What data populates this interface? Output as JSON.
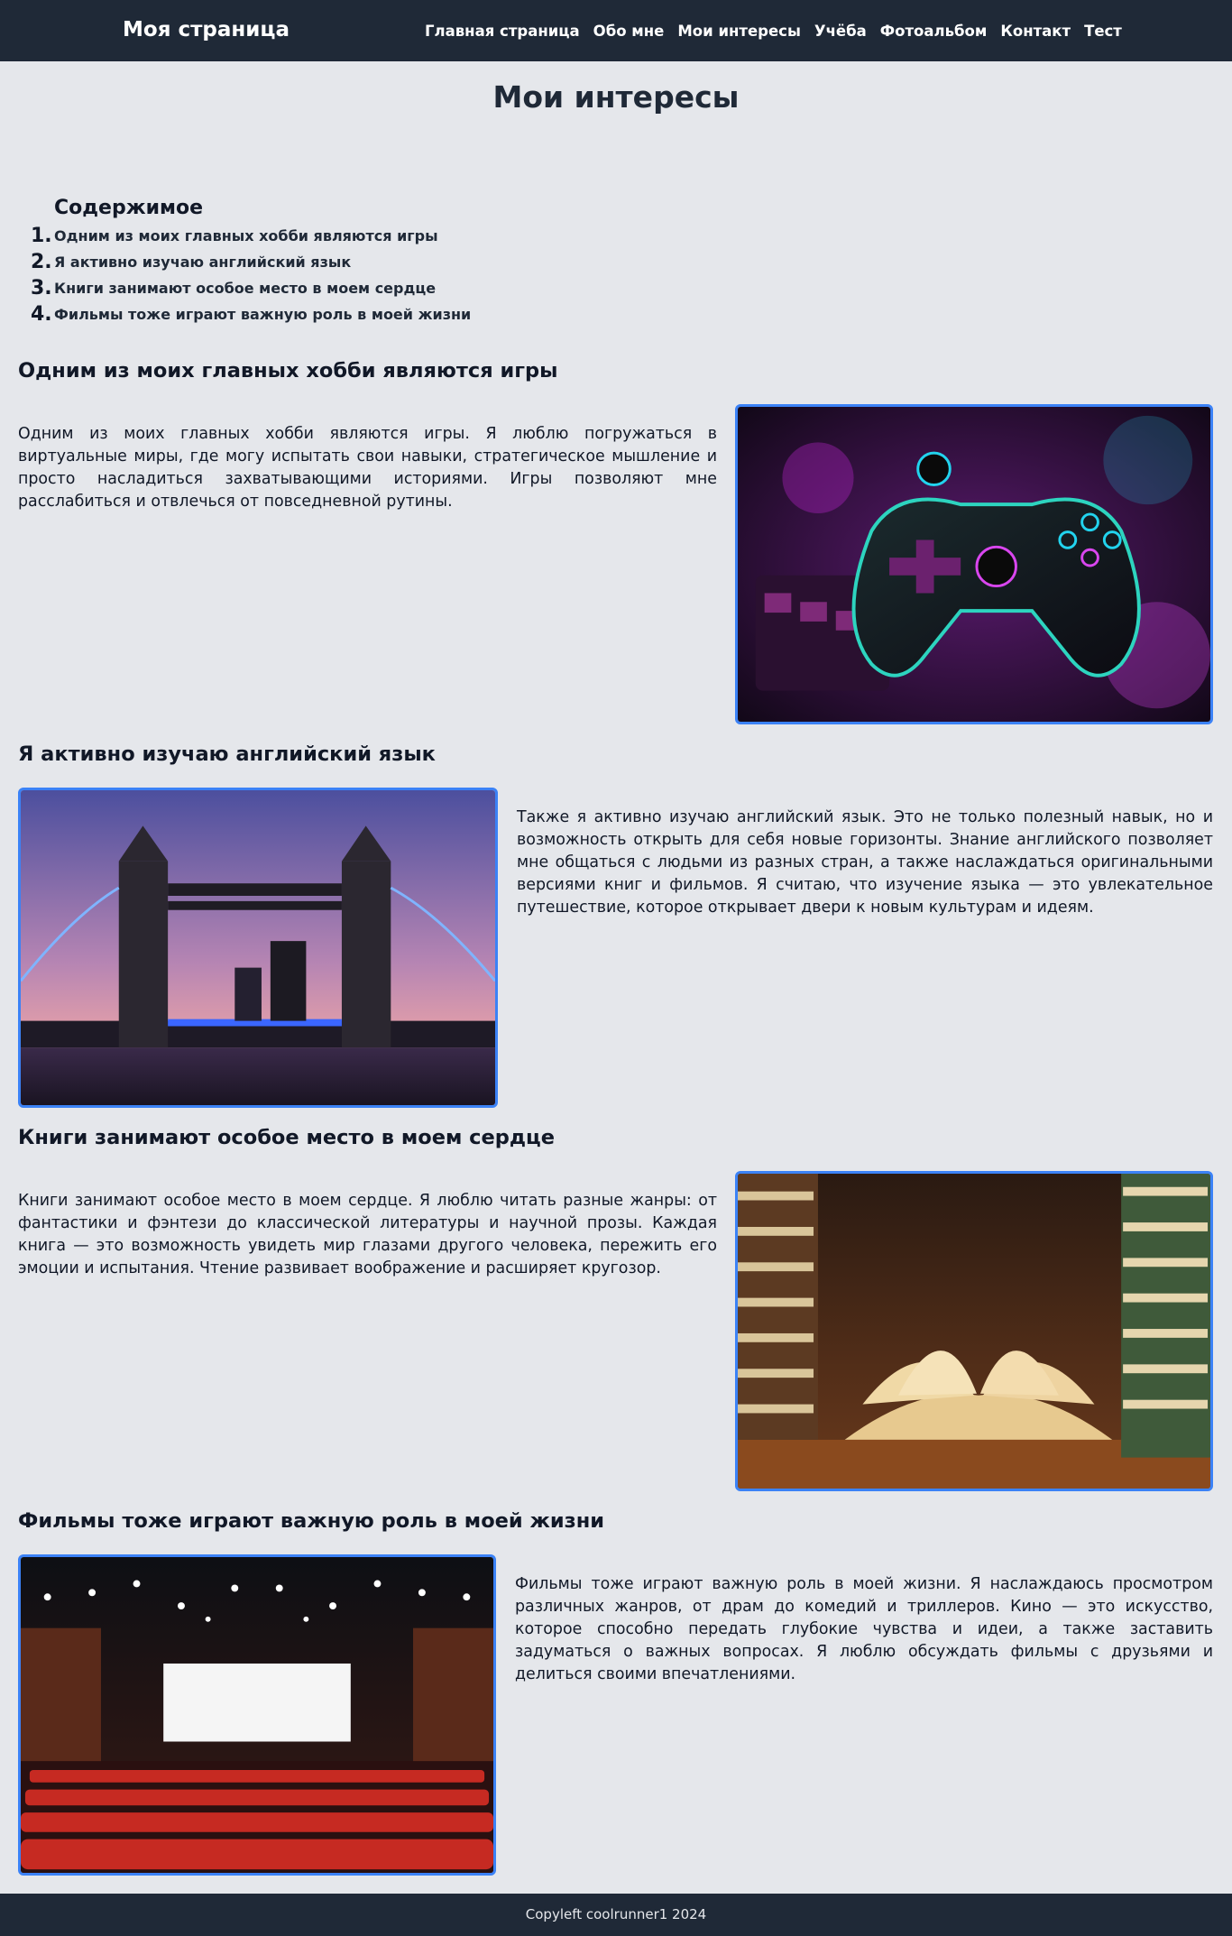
{
  "header": {
    "brand": "Моя страница",
    "nav": [
      "Главная страница",
      "Обо мне",
      "Мои интересы",
      "Учёба",
      "Фотоальбом",
      "Контакт",
      "Тест"
    ]
  },
  "page_title": "Мои интересы",
  "toc": {
    "title": "Содержимое",
    "items": [
      {
        "num": "1.",
        "label": "Одним из моих главных хобби являются игры"
      },
      {
        "num": "2.",
        "label": "Я активно изучаю английский язык"
      },
      {
        "num": "3.",
        "label": "Книги занимают особое место в моем сердце"
      },
      {
        "num": "4.",
        "label": "Фильмы тоже играют важную роль в моей жизни"
      }
    ]
  },
  "sections": [
    {
      "title": "Одним из моих главных хобби являются игры",
      "text": "Одним из моих главных хобби являются игры. Я люблю погружаться в виртуальные миры, где могу испытать свои навыки, стратегическое мышление и просто насладиться захватывающими историями. Игры позволяют мне расслабиться и отвлечься от повседневной рутины.",
      "image": "gamepad-image"
    },
    {
      "title": "Я активно изучаю английский язык",
      "text": "Также я активно изучаю английский язык. Это не только полезный навык, но и возможность открыть для себя новые горизонты. Знание английского позволяет мне общаться с людьми из разных стран, а также наслаждаться оригинальными версиями книг и фильмов. Я считаю, что изучение языка — это увлекательное путешествие, которое открывает двери к новым культурам и идеям.",
      "image": "tower-bridge-image"
    },
    {
      "title": "Книги занимают особое место в моем сердце",
      "text": "Книги занимают особое место в моем сердце. Я люблю читать разные жанры: от фантастики и фэнтези до классической литературы и научной прозы. Каждая книга — это возможность увидеть мир глазами другого человека, пережить его эмоции и испытания. Чтение развивает воображение и расширяет кругозор.",
      "image": "books-image"
    },
    {
      "title": "Фильмы тоже играют важную роль в моей жизни",
      "text": "Фильмы тоже играют важную роль в моей жизни. Я наслаждаюсь просмотром различных жанров, от драм до комедий и триллеров. Кино — это искусство, которое способно передать глубокие чувства и идеи, а также заставить задуматься о важных вопросах. Я люблю обсуждать фильмы с друзьями и делиться своими впечатлениями.",
      "image": "cinema-hall-image"
    }
  ],
  "footer": "Copyleft coolrunner1 2024",
  "colors": {
    "header_bg": "#1f2937",
    "page_bg": "#e5e7eb",
    "image_border": "#3b82f6"
  }
}
